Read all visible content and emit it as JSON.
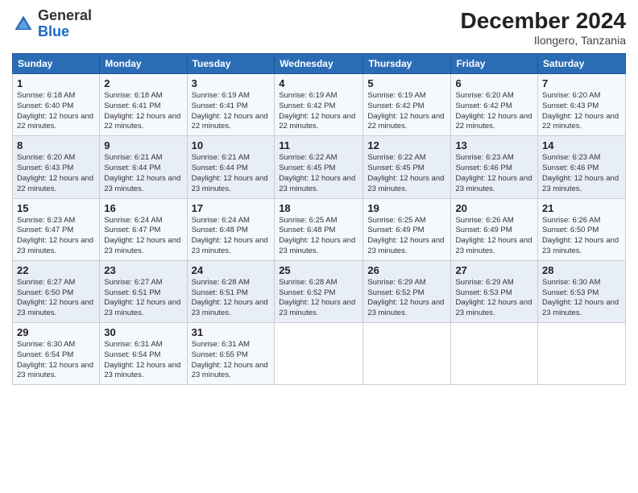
{
  "header": {
    "logo_general": "General",
    "logo_blue": "Blue",
    "title": "December 2024",
    "subtitle": "Ilongero, Tanzania"
  },
  "calendar": {
    "days_of_week": [
      "Sunday",
      "Monday",
      "Tuesday",
      "Wednesday",
      "Thursday",
      "Friday",
      "Saturday"
    ],
    "weeks": [
      [
        null,
        {
          "day": "2",
          "sunrise": "Sunrise: 6:18 AM",
          "sunset": "Sunset: 6:41 PM",
          "daylight": "Daylight: 12 hours and 22 minutes."
        },
        {
          "day": "3",
          "sunrise": "Sunrise: 6:19 AM",
          "sunset": "Sunset: 6:41 PM",
          "daylight": "Daylight: 12 hours and 22 minutes."
        },
        {
          "day": "4",
          "sunrise": "Sunrise: 6:19 AM",
          "sunset": "Sunset: 6:42 PM",
          "daylight": "Daylight: 12 hours and 22 minutes."
        },
        {
          "day": "5",
          "sunrise": "Sunrise: 6:19 AM",
          "sunset": "Sunset: 6:42 PM",
          "daylight": "Daylight: 12 hours and 22 minutes."
        },
        {
          "day": "6",
          "sunrise": "Sunrise: 6:20 AM",
          "sunset": "Sunset: 6:42 PM",
          "daylight": "Daylight: 12 hours and 22 minutes."
        },
        {
          "day": "7",
          "sunrise": "Sunrise: 6:20 AM",
          "sunset": "Sunset: 6:43 PM",
          "daylight": "Daylight: 12 hours and 22 minutes."
        }
      ],
      [
        {
          "day": "1",
          "sunrise": "Sunrise: 6:18 AM",
          "sunset": "Sunset: 6:40 PM",
          "daylight": "Daylight: 12 hours and 22 minutes."
        },
        {
          "day": "8",
          "sunrise": "Sunrise: 6:20 AM",
          "sunset": "Sunset: 6:43 PM",
          "daylight": "Daylight: 12 hours and 22 minutes."
        },
        {
          "day": "9",
          "sunrise": "Sunrise: 6:21 AM",
          "sunset": "Sunset: 6:44 PM",
          "daylight": "Daylight: 12 hours and 23 minutes."
        },
        {
          "day": "10",
          "sunrise": "Sunrise: 6:21 AM",
          "sunset": "Sunset: 6:44 PM",
          "daylight": "Daylight: 12 hours and 23 minutes."
        },
        {
          "day": "11",
          "sunrise": "Sunrise: 6:22 AM",
          "sunset": "Sunset: 6:45 PM",
          "daylight": "Daylight: 12 hours and 23 minutes."
        },
        {
          "day": "12",
          "sunrise": "Sunrise: 6:22 AM",
          "sunset": "Sunset: 6:45 PM",
          "daylight": "Daylight: 12 hours and 23 minutes."
        },
        {
          "day": "13",
          "sunrise": "Sunrise: 6:23 AM",
          "sunset": "Sunset: 6:46 PM",
          "daylight": "Daylight: 12 hours and 23 minutes."
        },
        {
          "day": "14",
          "sunrise": "Sunrise: 6:23 AM",
          "sunset": "Sunset: 6:46 PM",
          "daylight": "Daylight: 12 hours and 23 minutes."
        }
      ],
      [
        {
          "day": "15",
          "sunrise": "Sunrise: 6:23 AM",
          "sunset": "Sunset: 6:47 PM",
          "daylight": "Daylight: 12 hours and 23 minutes."
        },
        {
          "day": "16",
          "sunrise": "Sunrise: 6:24 AM",
          "sunset": "Sunset: 6:47 PM",
          "daylight": "Daylight: 12 hours and 23 minutes."
        },
        {
          "day": "17",
          "sunrise": "Sunrise: 6:24 AM",
          "sunset": "Sunset: 6:48 PM",
          "daylight": "Daylight: 12 hours and 23 minutes."
        },
        {
          "day": "18",
          "sunrise": "Sunrise: 6:25 AM",
          "sunset": "Sunset: 6:48 PM",
          "daylight": "Daylight: 12 hours and 23 minutes."
        },
        {
          "day": "19",
          "sunrise": "Sunrise: 6:25 AM",
          "sunset": "Sunset: 6:49 PM",
          "daylight": "Daylight: 12 hours and 23 minutes."
        },
        {
          "day": "20",
          "sunrise": "Sunrise: 6:26 AM",
          "sunset": "Sunset: 6:49 PM",
          "daylight": "Daylight: 12 hours and 23 minutes."
        },
        {
          "day": "21",
          "sunrise": "Sunrise: 6:26 AM",
          "sunset": "Sunset: 6:50 PM",
          "daylight": "Daylight: 12 hours and 23 minutes."
        }
      ],
      [
        {
          "day": "22",
          "sunrise": "Sunrise: 6:27 AM",
          "sunset": "Sunset: 6:50 PM",
          "daylight": "Daylight: 12 hours and 23 minutes."
        },
        {
          "day": "23",
          "sunrise": "Sunrise: 6:27 AM",
          "sunset": "Sunset: 6:51 PM",
          "daylight": "Daylight: 12 hours and 23 minutes."
        },
        {
          "day": "24",
          "sunrise": "Sunrise: 6:28 AM",
          "sunset": "Sunset: 6:51 PM",
          "daylight": "Daylight: 12 hours and 23 minutes."
        },
        {
          "day": "25",
          "sunrise": "Sunrise: 6:28 AM",
          "sunset": "Sunset: 6:52 PM",
          "daylight": "Daylight: 12 hours and 23 minutes."
        },
        {
          "day": "26",
          "sunrise": "Sunrise: 6:29 AM",
          "sunset": "Sunset: 6:52 PM",
          "daylight": "Daylight: 12 hours and 23 minutes."
        },
        {
          "day": "27",
          "sunrise": "Sunrise: 6:29 AM",
          "sunset": "Sunset: 6:53 PM",
          "daylight": "Daylight: 12 hours and 23 minutes."
        },
        {
          "day": "28",
          "sunrise": "Sunrise: 6:30 AM",
          "sunset": "Sunset: 6:53 PM",
          "daylight": "Daylight: 12 hours and 23 minutes."
        }
      ],
      [
        {
          "day": "29",
          "sunrise": "Sunrise: 6:30 AM",
          "sunset": "Sunset: 6:54 PM",
          "daylight": "Daylight: 12 hours and 23 minutes."
        },
        {
          "day": "30",
          "sunrise": "Sunrise: 6:31 AM",
          "sunset": "Sunset: 6:54 PM",
          "daylight": "Daylight: 12 hours and 23 minutes."
        },
        {
          "day": "31",
          "sunrise": "Sunrise: 6:31 AM",
          "sunset": "Sunset: 6:55 PM",
          "daylight": "Daylight: 12 hours and 23 minutes."
        },
        null,
        null,
        null,
        null
      ]
    ]
  }
}
